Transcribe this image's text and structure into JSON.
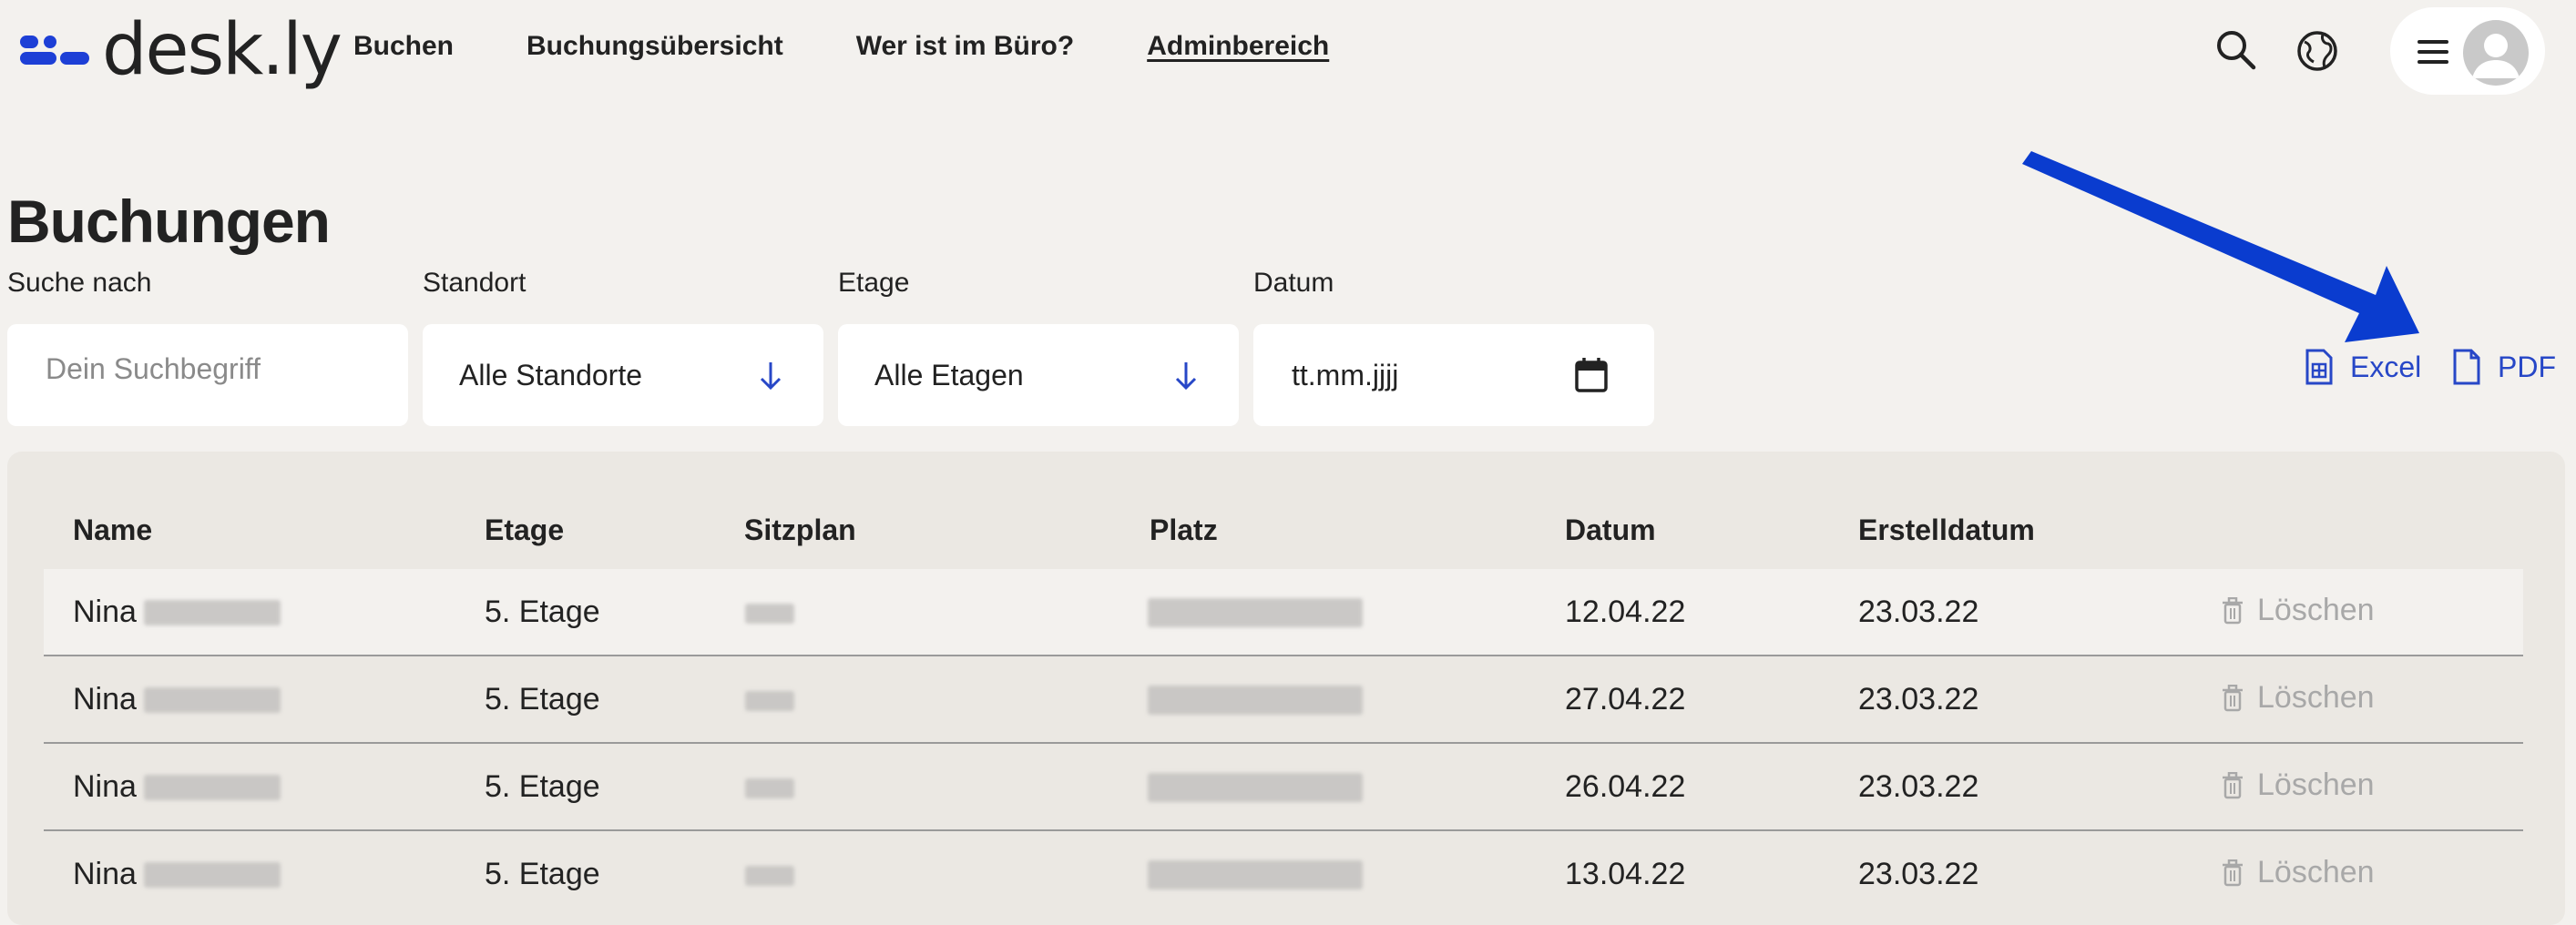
{
  "app": {
    "logo_text": "desk.ly",
    "brand_color": "#1d3fd6"
  },
  "nav": {
    "items": [
      {
        "label": "Buchen"
      },
      {
        "label": "Buchungsübersicht"
      },
      {
        "label": "Wer ist im Büro?"
      },
      {
        "label": "Adminbereich"
      }
    ]
  },
  "header_icons": [
    "search-icon",
    "globe-icon",
    "menu-icon",
    "avatar"
  ],
  "page": {
    "title": "Buchungen"
  },
  "filters": {
    "search": {
      "label": "Suche nach",
      "placeholder": "Dein Suchbegriff"
    },
    "location": {
      "label": "Standort",
      "value": "Alle Standorte"
    },
    "floor": {
      "label": "Etage",
      "value": "Alle Etagen"
    },
    "date": {
      "label": "Datum",
      "value": "tt.mm.jjjj"
    }
  },
  "exports": {
    "excel": "Excel",
    "pdf": "PDF",
    "color": "#2747c7"
  },
  "table": {
    "columns": [
      "Name",
      "Etage",
      "Sitzplan",
      "Platz",
      "Datum",
      "Erstelldatum"
    ],
    "rows": [
      {
        "name": "Nina",
        "floor": "5. Etage",
        "date": "12.04.22",
        "created": "23.03.22",
        "action": "Löschen"
      },
      {
        "name": "Nina",
        "floor": "5. Etage",
        "date": "27.04.22",
        "created": "23.03.22",
        "action": "Löschen"
      },
      {
        "name": "Nina",
        "floor": "5. Etage",
        "date": "26.04.22",
        "created": "23.03.22",
        "action": "Löschen"
      },
      {
        "name": "Nina",
        "floor": "5. Etage",
        "date": "13.04.22",
        "created": "23.03.22",
        "action": "Löschen"
      }
    ]
  },
  "annotation": {
    "arrow_color": "#0a3ccf"
  }
}
